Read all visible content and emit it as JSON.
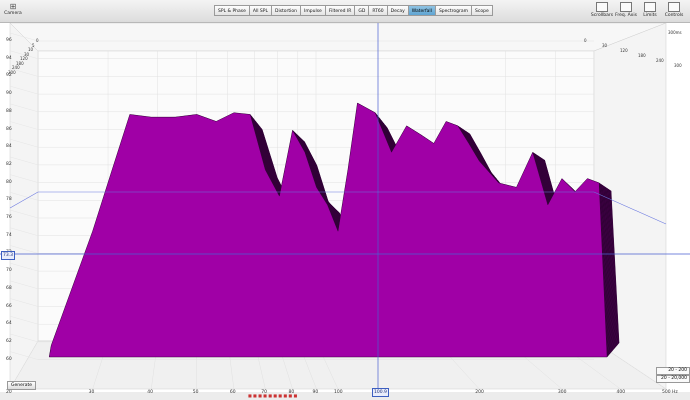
{
  "app": {
    "camera_label": "Camera",
    "generate_label": "Generate"
  },
  "tabs": [
    "SPL & Phase",
    "All SPL",
    "Distortion",
    "Impulse",
    "Filtered IR",
    "GD",
    "RT60",
    "Decay",
    "Waterfall",
    "Spectrogram",
    "Scope"
  ],
  "active_tab": "Waterfall",
  "right_tools": [
    "Scrollbars",
    "Freq. Axis",
    "Limits",
    "Controls"
  ],
  "y_axis": {
    "labels": [
      "96",
      "94",
      "92",
      "90",
      "88",
      "86",
      "84",
      "82",
      "80",
      "78",
      "76",
      "74",
      "72",
      "70",
      "68",
      "66",
      "64",
      "62",
      "60"
    ],
    "cursor_value": "73.3"
  },
  "x_axis": {
    "labels": [
      "20",
      "30",
      "40",
      "50",
      "60",
      "70",
      "80",
      "90",
      "100",
      "200",
      "300",
      "400",
      "500 Hz"
    ],
    "cursor_value": "100.9"
  },
  "depth_labels_left": [
    "0",
    "5",
    "10",
    "30",
    "120",
    "180",
    "240",
    "300"
  ],
  "depth_labels_right": [
    "0",
    "30",
    "120",
    "180",
    "240",
    "300"
  ],
  "depth_unit": "300ms",
  "range_boxes": [
    "20 - 200",
    "20 - 20,000"
  ],
  "legend_text": "■ ■ ■ ■ ■ ■ ■ ■ ■ ■",
  "chart_data": {
    "type": "area",
    "title": "",
    "xlabel": "",
    "ylabel": "",
    "xscale": "log",
    "xlim": [
      20,
      500
    ],
    "ylim": [
      60,
      97
    ],
    "slices_ms": [
      0,
      300
    ],
    "series": [
      {
        "x": [
          27,
          30,
          33,
          36,
          40,
          45,
          50,
          55,
          60,
          65,
          70,
          75,
          80,
          85,
          90,
          95,
          100,
          105,
          110,
          120,
          130,
          140,
          150,
          160,
          170,
          180,
          190,
          200,
          220,
          240,
          260,
          280,
          300,
          320,
          340,
          360
        ],
        "y": [
          62,
          75,
          82,
          88.3,
          88,
          88,
          88.3,
          87.5,
          88.5,
          88.3,
          82,
          79,
          86.5,
          84,
          80,
          78,
          75,
          82,
          89.6,
          88.5,
          84,
          87,
          86,
          85,
          87.5,
          87,
          85,
          83,
          80.5,
          80,
          84,
          78,
          81,
          79.5,
          81,
          80.5
        ]
      }
    ]
  }
}
